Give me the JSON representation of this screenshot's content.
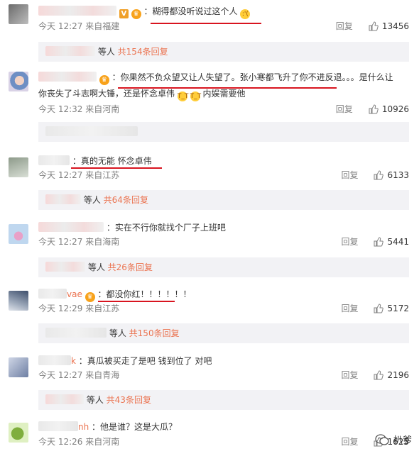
{
  "comments": [
    {
      "avatar": "avatar-photo",
      "username": "",
      "text": "：糊得都没听说过这个人",
      "emoji": "sad-cry",
      "time": "今天 12:27",
      "location": "来自福建",
      "reply_label": "回复",
      "likes": "13456",
      "thread": {
        "suffix": "等人",
        "count_label": "共154条回复"
      }
    },
    {
      "avatar": "avatar-photo",
      "username": "",
      "text_line1": "：你果然不负众望又让人失望了。张小寒都飞升了你不进反退。。。是什么让",
      "text_line2": "你丧失了斗志啊大锤，还是怀念卓伟",
      "text_line2_tail": "内娱需要他",
      "time": "今天 12:32",
      "location": "来自河南",
      "reply_label": "回复",
      "likes": "10926"
    },
    {
      "avatar": "avatar-photo",
      "username": "",
      "text": "：真的无能 怀念卓伟",
      "time": "今天 12:27",
      "location": "来自江苏",
      "reply_label": "回复",
      "likes": "6133",
      "thread": {
        "suffix": "等人",
        "count_label": "共64条回复"
      }
    },
    {
      "avatar": "avatar-photo",
      "username": "",
      "text": "：实在不行你就找个厂子上班吧",
      "time": "今天 12:27",
      "location": "来自海南",
      "reply_label": "回复",
      "likes": "5441",
      "thread": {
        "suffix": "等人",
        "count_label": "共26条回复"
      }
    },
    {
      "avatar": "avatar-photo",
      "username": "vae",
      "text": "：都没你红！！！！！！",
      "time": "今天 12:29",
      "location": "来自江苏",
      "reply_label": "回复",
      "likes": "5172",
      "thread": {
        "suffix": "等人",
        "count_label": "共150条回复"
      }
    },
    {
      "avatar": "avatar-photo",
      "username": "k",
      "text": "：真瓜被买走了是吧 钱到位了 对吧",
      "time": "今天 12:27",
      "location": "来自青海",
      "reply_label": "回复",
      "likes": "2196",
      "thread": {
        "suffix": "等人",
        "count_label": "共43条回复"
      }
    },
    {
      "avatar": "avatar-photo",
      "username": "nh",
      "text": "：他是谁？这是大瓜？",
      "time": "今天 12:26",
      "location": "来自河南",
      "reply_label": "回复",
      "likes": "1625"
    }
  ],
  "watermark": {
    "icon": "wechat-icon",
    "text": "扒爹"
  },
  "colors": {
    "accent": "#eb7350",
    "underline": "#d8141f",
    "meta": "#808080",
    "subbox": "#f2f2f5"
  }
}
